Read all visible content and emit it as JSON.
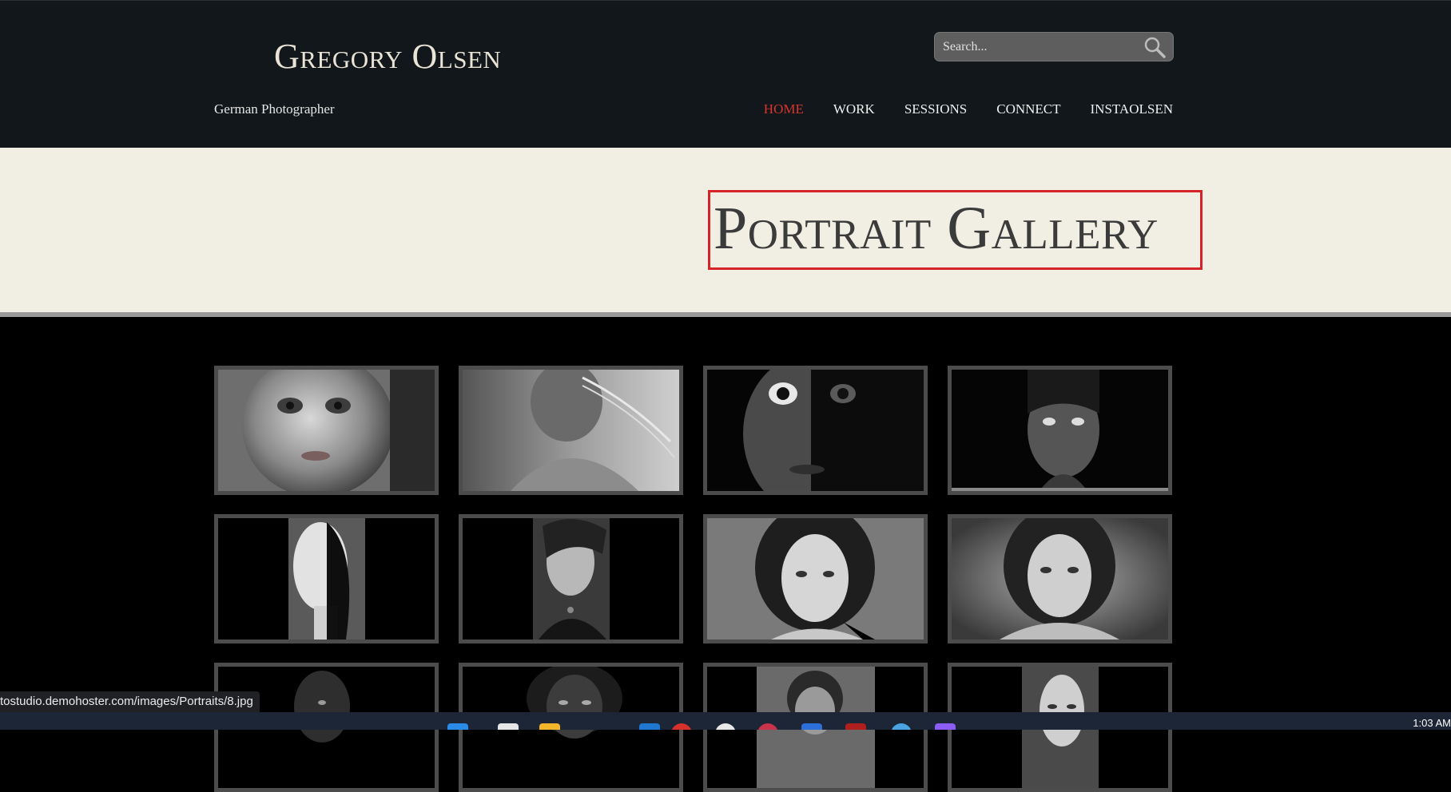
{
  "header": {
    "site_title": "Gregory Olsen",
    "tagline": "German Photographer",
    "search": {
      "placeholder": "Search...",
      "icon": "search-icon"
    },
    "nav": [
      {
        "label": "HOME",
        "active": true
      },
      {
        "label": "WORK",
        "active": false
      },
      {
        "label": "SESSIONS",
        "active": false
      },
      {
        "label": "CONNECT",
        "active": false
      },
      {
        "label": "INSTAOLSEN",
        "active": false
      }
    ]
  },
  "banner": {
    "title": "Portrait Gallery"
  },
  "gallery": {
    "items": [
      {
        "name": "portrait-child-face",
        "tone": "light"
      },
      {
        "name": "portrait-woman-windblown-hair",
        "tone": "light"
      },
      {
        "name": "portrait-boy-half-shadow",
        "tone": "dark"
      },
      {
        "name": "portrait-girl-freckles",
        "tone": "dark"
      },
      {
        "name": "portrait-half-painted-face",
        "tone": "narrow"
      },
      {
        "name": "portrait-woman-short-hair",
        "tone": "narrow"
      },
      {
        "name": "portrait-girl-bob-haircut",
        "tone": "light"
      },
      {
        "name": "portrait-woman-studio",
        "tone": "light"
      },
      {
        "name": "portrait-row3-1",
        "tone": "dark"
      },
      {
        "name": "portrait-row3-2",
        "tone": "dark"
      },
      {
        "name": "portrait-row3-3",
        "tone": "narrow"
      },
      {
        "name": "portrait-row3-4",
        "tone": "narrow"
      }
    ]
  },
  "status_bar": {
    "url": "tostudio.demohoster.com/images/Portraits/8.jpg"
  },
  "taskbar": {
    "clock": "1:03 AM"
  },
  "colors": {
    "header_bg": "#11171a",
    "banner_bg": "#f1efe3",
    "accent_red": "#d8352e",
    "highlight_box": "#d5232a"
  }
}
